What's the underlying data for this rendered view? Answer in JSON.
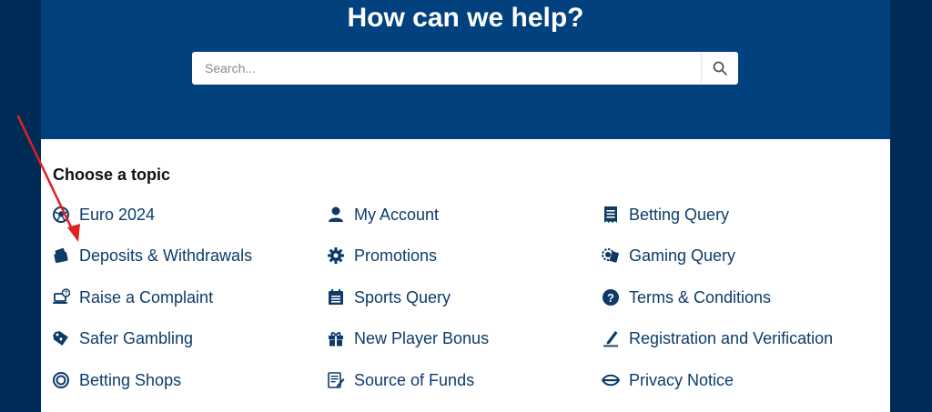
{
  "hero": {
    "title": "How can we help?",
    "search_placeholder": "Search...",
    "search_icon": "search-icon"
  },
  "topics": {
    "heading": "Choose a topic",
    "items": [
      {
        "label": "Euro 2024",
        "icon": "soccer-ball-icon"
      },
      {
        "label": "Deposits & Withdrawals",
        "icon": "wallet-cards-icon"
      },
      {
        "label": "Raise a Complaint",
        "icon": "laptop-question-icon"
      },
      {
        "label": "Safer Gambling",
        "icon": "tag-heart-icon"
      },
      {
        "label": "Betting Shops",
        "icon": "circle-ring-icon"
      },
      {
        "label": "My Account",
        "icon": "user-icon"
      },
      {
        "label": "Promotions",
        "icon": "gear-badge-icon"
      },
      {
        "label": "Sports Query",
        "icon": "calendar-list-icon"
      },
      {
        "label": "New Player Bonus",
        "icon": "gift-icon"
      },
      {
        "label": "Source of Funds",
        "icon": "document-pen-icon"
      },
      {
        "label": "Betting Query",
        "icon": "receipt-icon"
      },
      {
        "label": "Gaming Query",
        "icon": "chips-cards-icon"
      },
      {
        "label": "Terms & Conditions",
        "icon": "question-circle-icon"
      },
      {
        "label": "Registration and Verification",
        "icon": "pencil-line-icon"
      },
      {
        "label": "Privacy Notice",
        "icon": "eye-shield-icon"
      }
    ]
  },
  "annotation": {
    "color": "#e02020",
    "icon": "red-arrow-annotation"
  },
  "colors": {
    "background": "#012b57",
    "hero": "#00417e",
    "link": "#0c3c6b",
    "icon": "#0d3a66"
  }
}
